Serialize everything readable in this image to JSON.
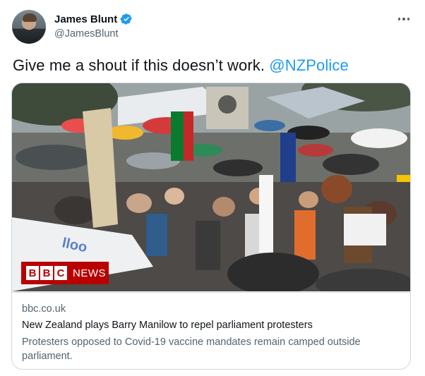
{
  "author": {
    "display_name": "James Blunt",
    "handle": "@JamesBlunt",
    "verified": true,
    "avatar_icon": "user-avatar"
  },
  "tweet": {
    "text": "Give me a shout if this doesn’t work. ",
    "mention": "@NZPolice"
  },
  "card": {
    "image_icon": "protest-crowd-photo",
    "badge": {
      "letters": [
        "B",
        "B",
        "C"
      ],
      "news": "NEWS"
    },
    "domain": "bbc.co.uk",
    "title": "New Zealand plays Barry Manilow to repel parliament protesters",
    "description": "Protesters opposed to Covid-19 vaccine mandates remain camped outside parliament."
  },
  "colors": {
    "link": "#1d9bf0",
    "secondary_text": "#536471",
    "border": "#cfd9de",
    "bbc_red": "#b80000"
  }
}
